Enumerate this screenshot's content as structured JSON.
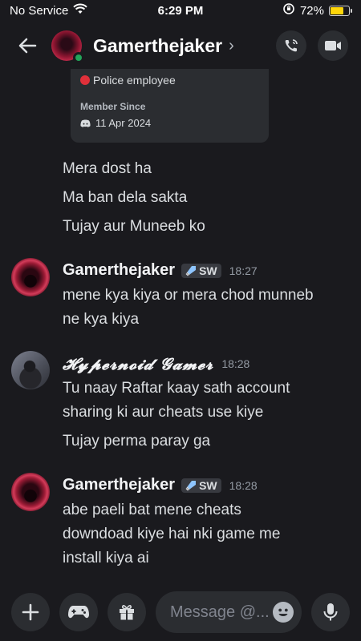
{
  "status_bar": {
    "carrier": "No Service",
    "time": "6:29 PM",
    "battery": "72%",
    "battery_level": 0.72,
    "icons": [
      "wifi-icon",
      "screen-lock-rotation-icon",
      "battery-icon"
    ]
  },
  "header": {
    "title": "Gamerthejaker",
    "chevron": "›",
    "actions": [
      "voice-call-icon",
      "video-call-icon"
    ]
  },
  "profile_card": {
    "role": "Police employee",
    "member_since_label": "Member Since",
    "member_since_date": "11 Apr 2024"
  },
  "messages": [
    {
      "text": "Mera dost ha"
    },
    {
      "text": "Ma ban dela sakta"
    },
    {
      "text": "Tujay aur Muneeb ko"
    }
  ],
  "message_groups": [
    {
      "author": "Gamerthejaker",
      "tag": "SW",
      "time": "18:27",
      "lines": [
        "mene kya kiya or mera chod munneb",
        "ne kya kiya"
      ]
    },
    {
      "author": "𝓗𝔂𝓹𝓮𝓻𝓷𝓸𝓲𝓭 𝓖𝓪𝓶𝓮𝓻",
      "time": "18:28",
      "lines": [
        "Tu naay Raftar kaay sath account",
        "sharing ki aur cheats use kiye"
      ],
      "extra": "Tujay perma paray ga"
    },
    {
      "author": "Gamerthejaker",
      "tag": "SW",
      "time": "18:28",
      "lines": [
        "abe paeli bat mene cheats",
        "downdoad kiye hai nki game me",
        "install kiya ai"
      ]
    }
  ],
  "composer": {
    "placeholder": "Message @...",
    "buttons": [
      "plus-icon",
      "gamepad-icon",
      "gift-icon"
    ],
    "emoji": "emoji-icon",
    "mic": "microphone-icon"
  },
  "colors": {
    "background": "#1a1a1e",
    "surface": "#2b2d31",
    "online": "#23a55a",
    "battery": "#ffd60a",
    "role_dot": "#e0303a"
  }
}
